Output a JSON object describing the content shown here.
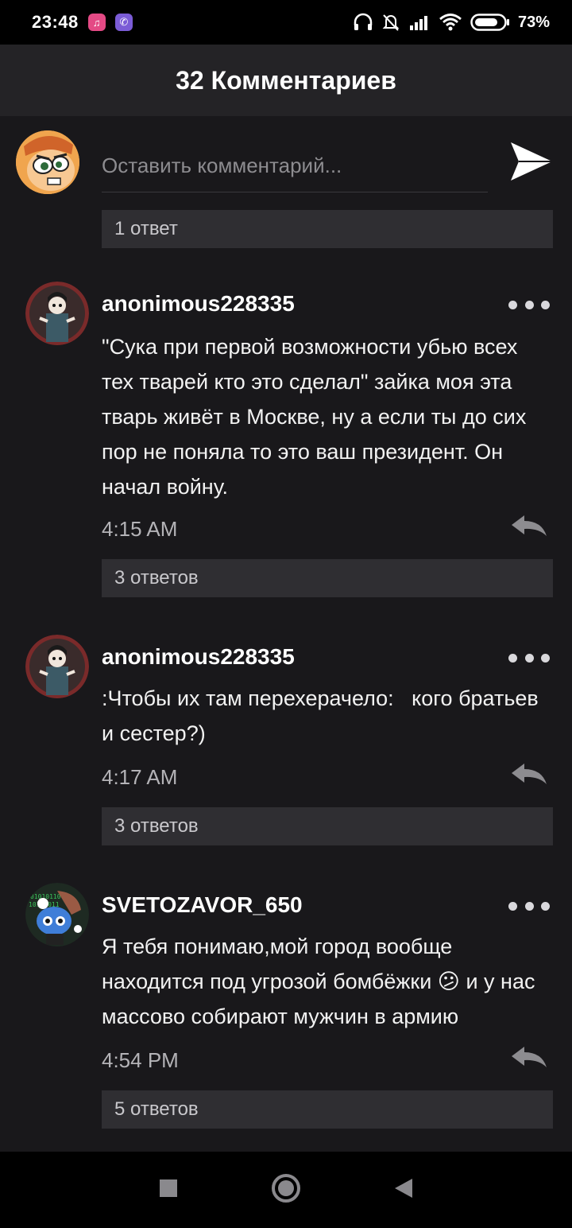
{
  "status": {
    "time": "23:48",
    "battery": "73%"
  },
  "header": {
    "title": "32 Комментариев"
  },
  "compose": {
    "placeholder": "Оставить комментарий...",
    "top_replies": "1 ответ"
  },
  "comments": [
    {
      "username": "anonimous228335",
      "text": "\"Сука при первой возможности убью всех тех тварей кто это сделал\" зайка моя эта тварь живёт в Москве, ну а если ты до сих пор не поняла то это ваш президент. Он начал войну.",
      "time": "4:15 AM",
      "replies": "3 ответов"
    },
    {
      "username": "anonimous228335",
      "text": ":Чтобы их там перехерачело:   кого братьев и сестер?)",
      "time": "4:17 AM",
      "replies": "3 ответов"
    },
    {
      "username": "SVETOZAVOR_650",
      "text": "Я тебя понимаю,мой город вообще находится под угрозой бомбёжки 😕 и у нас массово собирают мужчин в армию",
      "time": "4:54 PM",
      "replies": "5 ответов"
    }
  ],
  "icons": {
    "status": [
      "music-app-icon",
      "viber-icon",
      "headphones-icon",
      "bell-muted-icon",
      "signal-icon",
      "wifi-icon",
      "battery-icon"
    ],
    "nav": [
      "recent-apps-icon",
      "home-icon",
      "back-icon"
    ]
  }
}
